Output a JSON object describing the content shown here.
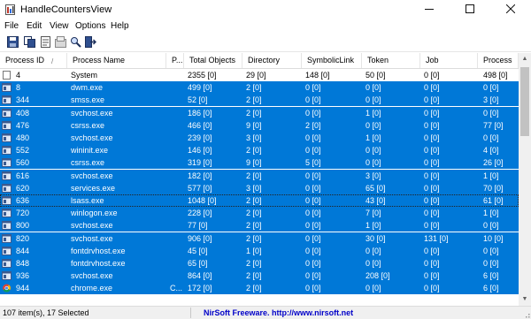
{
  "window": {
    "title": "HandleCountersView"
  },
  "menu": [
    "File",
    "Edit",
    "View",
    "Options",
    "Help"
  ],
  "toolbar": [
    "save-icon",
    "copy-icon",
    "properties-icon",
    "html-report-icon",
    "find-icon",
    "exit-icon"
  ],
  "columns": [
    "Process ID",
    "Process Name",
    "P...",
    "Total Objects",
    "Directory",
    "SymbolicLink",
    "Token",
    "Job",
    "Process"
  ],
  "rows": [
    {
      "pid": "4",
      "name": "System",
      "p": "",
      "total": "2355 [0]",
      "dir": "29 [0]",
      "sym": "148 [0]",
      "token": "50 [0]",
      "job": "0 [0]",
      "proc": "498 [0]",
      "selected": false,
      "icon": "blank-process-icon"
    },
    {
      "pid": "8",
      "name": "dwm.exe",
      "p": "",
      "total": "499 [0]",
      "dir": "2 [0]",
      "sym": "0 [0]",
      "token": "0 [0]",
      "job": "0 [0]",
      "proc": "0 [0]",
      "selected": true,
      "icon": "process-icon"
    },
    {
      "pid": "344",
      "name": "smss.exe",
      "p": "",
      "total": "52 [0]",
      "dir": "2 [0]",
      "sym": "0 [0]",
      "token": "0 [0]",
      "job": "0 [0]",
      "proc": "3 [0]",
      "selected": true,
      "icon": "process-icon"
    },
    {
      "pid": "408",
      "name": "svchost.exe",
      "p": "",
      "total": "186 [0]",
      "dir": "2 [0]",
      "sym": "0 [0]",
      "token": "1 [0]",
      "job": "0 [0]",
      "proc": "0 [0]",
      "selected": true,
      "icon": "process-icon"
    },
    {
      "pid": "476",
      "name": "csrss.exe",
      "p": "",
      "total": "466 [0]",
      "dir": "9 [0]",
      "sym": "2 [0]",
      "token": "0 [0]",
      "job": "0 [0]",
      "proc": "77 [0]",
      "selected": true,
      "icon": "process-icon"
    },
    {
      "pid": "480",
      "name": "svchost.exe",
      "p": "",
      "total": "239 [0]",
      "dir": "3 [0]",
      "sym": "0 [0]",
      "token": "1 [0]",
      "job": "0 [0]",
      "proc": "0 [0]",
      "selected": true,
      "icon": "process-icon"
    },
    {
      "pid": "552",
      "name": "wininit.exe",
      "p": "",
      "total": "146 [0]",
      "dir": "2 [0]",
      "sym": "0 [0]",
      "token": "0 [0]",
      "job": "0 [0]",
      "proc": "4 [0]",
      "selected": true,
      "icon": "process-icon"
    },
    {
      "pid": "560",
      "name": "csrss.exe",
      "p": "",
      "total": "319 [0]",
      "dir": "9 [0]",
      "sym": "5 [0]",
      "token": "0 [0]",
      "job": "0 [0]",
      "proc": "26 [0]",
      "selected": true,
      "icon": "process-icon"
    },
    {
      "pid": "616",
      "name": "svchost.exe",
      "p": "",
      "total": "182 [0]",
      "dir": "2 [0]",
      "sym": "0 [0]",
      "token": "3 [0]",
      "job": "0 [0]",
      "proc": "1 [0]",
      "selected": true,
      "icon": "process-icon"
    },
    {
      "pid": "620",
      "name": "services.exe",
      "p": "",
      "total": "577 [0]",
      "dir": "3 [0]",
      "sym": "0 [0]",
      "token": "65 [0]",
      "job": "0 [0]",
      "proc": "70 [0]",
      "selected": true,
      "icon": "process-icon"
    },
    {
      "pid": "636",
      "name": "lsass.exe",
      "p": "",
      "total": "1048 [0]",
      "dir": "2 [0]",
      "sym": "0 [0]",
      "token": "43 [0]",
      "job": "0 [0]",
      "proc": "61 [0]",
      "selected": true,
      "focused": true,
      "icon": "process-icon"
    },
    {
      "pid": "720",
      "name": "winlogon.exe",
      "p": "",
      "total": "228 [0]",
      "dir": "2 [0]",
      "sym": "0 [0]",
      "token": "7 [0]",
      "job": "0 [0]",
      "proc": "1 [0]",
      "selected": true,
      "icon": "process-icon"
    },
    {
      "pid": "800",
      "name": "svchost.exe",
      "p": "",
      "total": "77 [0]",
      "dir": "2 [0]",
      "sym": "0 [0]",
      "token": "1 [0]",
      "job": "0 [0]",
      "proc": "0 [0]",
      "selected": true,
      "icon": "process-icon"
    },
    {
      "pid": "820",
      "name": "svchost.exe",
      "p": "",
      "total": "906 [0]",
      "dir": "2 [0]",
      "sym": "0 [0]",
      "token": "30 [0]",
      "job": "131 [0]",
      "proc": "10 [0]",
      "selected": true,
      "icon": "process-icon"
    },
    {
      "pid": "844",
      "name": "fontdrvhost.exe",
      "p": "",
      "total": "45 [0]",
      "dir": "1 [0]",
      "sym": "0 [0]",
      "token": "0 [0]",
      "job": "0 [0]",
      "proc": "0 [0]",
      "selected": true,
      "icon": "process-icon"
    },
    {
      "pid": "848",
      "name": "fontdrvhost.exe",
      "p": "",
      "total": "65 [0]",
      "dir": "2 [0]",
      "sym": "0 [0]",
      "token": "0 [0]",
      "job": "0 [0]",
      "proc": "0 [0]",
      "selected": true,
      "icon": "process-icon"
    },
    {
      "pid": "936",
      "name": "svchost.exe",
      "p": "",
      "total": "864 [0]",
      "dir": "2 [0]",
      "sym": "0 [0]",
      "token": "208 [0]",
      "job": "0 [0]",
      "proc": "6 [0]",
      "selected": true,
      "icon": "process-icon"
    },
    {
      "pid": "944",
      "name": "chrome.exe",
      "p": "C...",
      "total": "172 [0]",
      "dir": "2 [0]",
      "sym": "0 [0]",
      "token": "0 [0]",
      "job": "0 [0]",
      "proc": "6 [0]",
      "selected": true,
      "icon": "chrome-icon"
    }
  ],
  "status": {
    "items": "107 item(s), 17 Selected",
    "credit": "NirSoft Freeware.  http://www.nirsoft.net"
  },
  "colors": {
    "selection": "#0078d7",
    "credit_link": "#0000c8"
  }
}
